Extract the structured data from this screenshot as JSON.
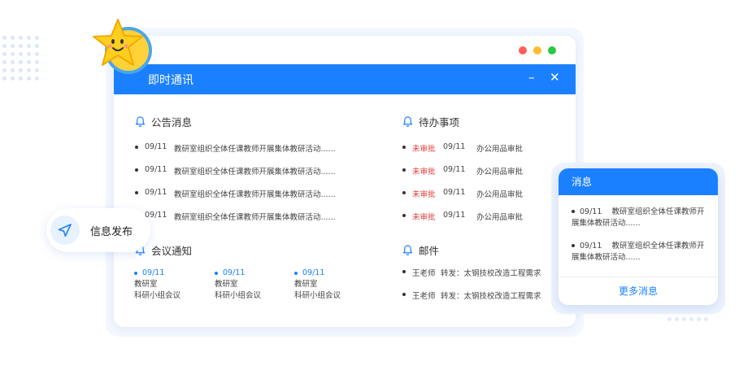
{
  "window": {
    "title": "即时通讯",
    "minimize": "–",
    "close": "✕",
    "traffic_colors": [
      "#ff5f57",
      "#febc2e",
      "#28c840"
    ]
  },
  "notices": {
    "heading": "公告消息",
    "items": [
      {
        "date": "09/11",
        "text": "教研室组织全体任课教师开展集体教研活动......"
      },
      {
        "date": "09/11",
        "text": "教研室组织全体任课教师开展集体教研活动......"
      },
      {
        "date": "09/11",
        "text": "教研室组织全体任课教师开展集体教研活动......"
      },
      {
        "date": "09/11",
        "text": "教研室组织全体任课教师开展集体教研活动......"
      }
    ]
  },
  "todo": {
    "heading": "待办事项",
    "items": [
      {
        "status": "未审批",
        "date": "09/11",
        "text": "办公用品审批"
      },
      {
        "status": "未审批",
        "date": "09/11",
        "text": "办公用品审批"
      },
      {
        "status": "未审批",
        "date": "09/11",
        "text": "办公用品审批"
      },
      {
        "status": "未审批",
        "date": "09/11",
        "text": "办公用品审批"
      }
    ]
  },
  "meetings": {
    "heading": "会议通知",
    "items": [
      {
        "date": "09/11",
        "org": "教研室",
        "title": "科研小组会议"
      },
      {
        "date": "09/11",
        "org": "教研室",
        "title": "科研小组会议"
      },
      {
        "date": "09/11",
        "org": "教研室",
        "title": "科研小组会议"
      }
    ]
  },
  "mail": {
    "heading": "邮件",
    "items": [
      {
        "from": "王老师",
        "text": "转发：太钢技校改造工程需求"
      },
      {
        "from": "王老师",
        "text": "转发：太钢技校改造工程需求"
      }
    ]
  },
  "publish": {
    "label": "信息发布",
    "icon": "send-icon"
  },
  "messages": {
    "heading": "消息",
    "items": [
      {
        "date": "09/11",
        "text": "教研室组织全体任课教师开展集体教研活动......"
      },
      {
        "date": "09/11",
        "text": "教研室组织全体任课教师开展集体教研活动......"
      }
    ],
    "more": "更多消息"
  },
  "colors": {
    "accent": "#1a80ff",
    "alert": "#e43c3c"
  }
}
